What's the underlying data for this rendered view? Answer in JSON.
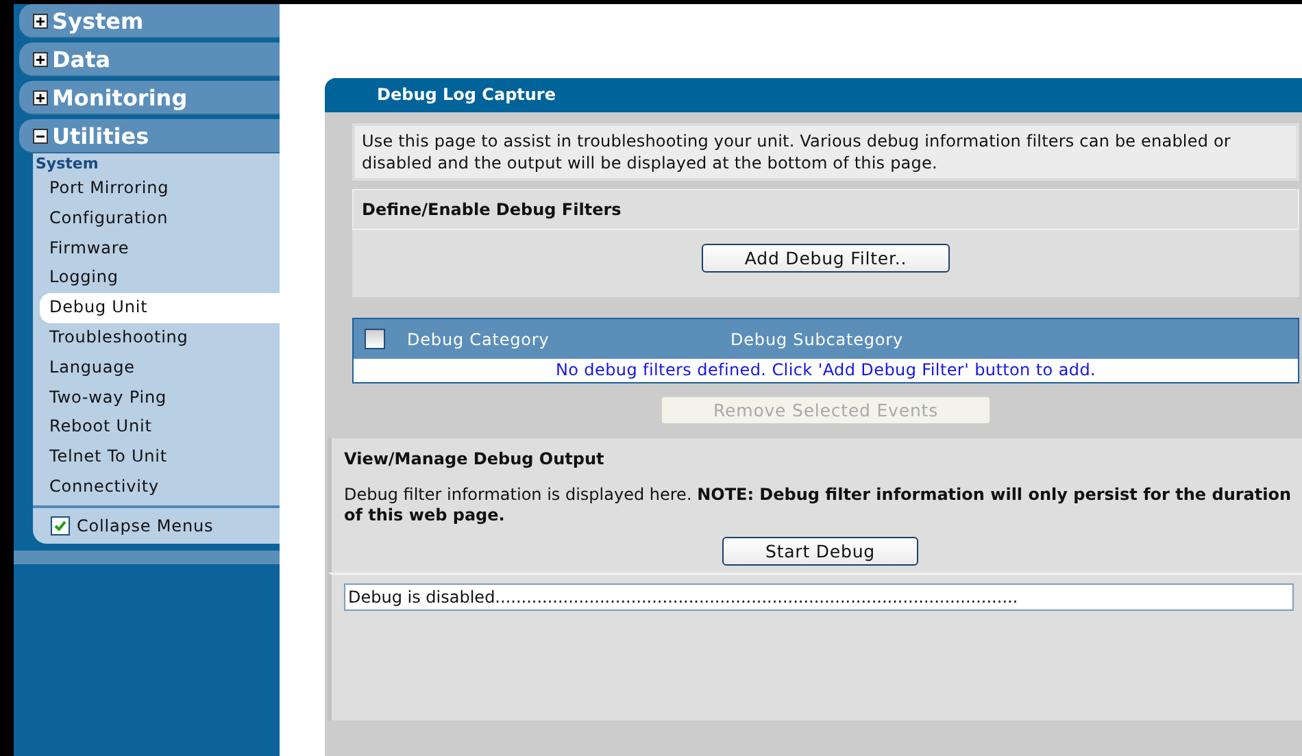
{
  "sidebar": {
    "sections": [
      {
        "label": "System",
        "expanded": false
      },
      {
        "label": "Data",
        "expanded": false
      },
      {
        "label": "Monitoring",
        "expanded": false
      },
      {
        "label": "Utilities",
        "expanded": true,
        "subheading": "System",
        "items": [
          {
            "label": "Port Mirroring",
            "selected": false
          },
          {
            "label": "Configuration",
            "selected": false
          },
          {
            "label": "Firmware",
            "selected": false
          },
          {
            "label": "Logging",
            "selected": false
          },
          {
            "label": "Debug Unit",
            "selected": true
          },
          {
            "label": "Troubleshooting",
            "selected": false
          },
          {
            "label": "Language",
            "selected": false
          },
          {
            "label": "Two-way Ping",
            "selected": false
          },
          {
            "label": "Reboot Unit",
            "selected": false
          },
          {
            "label": "Telnet To Unit",
            "selected": false
          },
          {
            "label": "Connectivity",
            "selected": false
          }
        ]
      }
    ],
    "collapse_menus": {
      "label": "Collapse Menus",
      "checked": true
    }
  },
  "panel": {
    "title": "Debug Log Capture",
    "intro": "Use this page to assist in troubleshooting your unit. Various debug information filters can be enabled or disabled and the output will be displayed at the bottom of this page.",
    "filters_heading": "Define/Enable Debug Filters",
    "add_button": "Add Debug Filter..",
    "table": {
      "select_all_checked": false,
      "columns": [
        "Debug Category",
        "Debug Subcategory"
      ],
      "empty_message": "No debug filters defined. Click 'Add Debug Filter' button to add."
    },
    "remove_button": {
      "label": "Remove Selected Events",
      "disabled": true
    },
    "output_heading": "View/Manage Debug Output",
    "output_note": "Debug filter information is displayed here. **NOTE: Debug filter information will only persist for the duration of this web page.**",
    "start_button": "Start Debug",
    "output_value": "Debug is disabled...................................................................................................."
  }
}
